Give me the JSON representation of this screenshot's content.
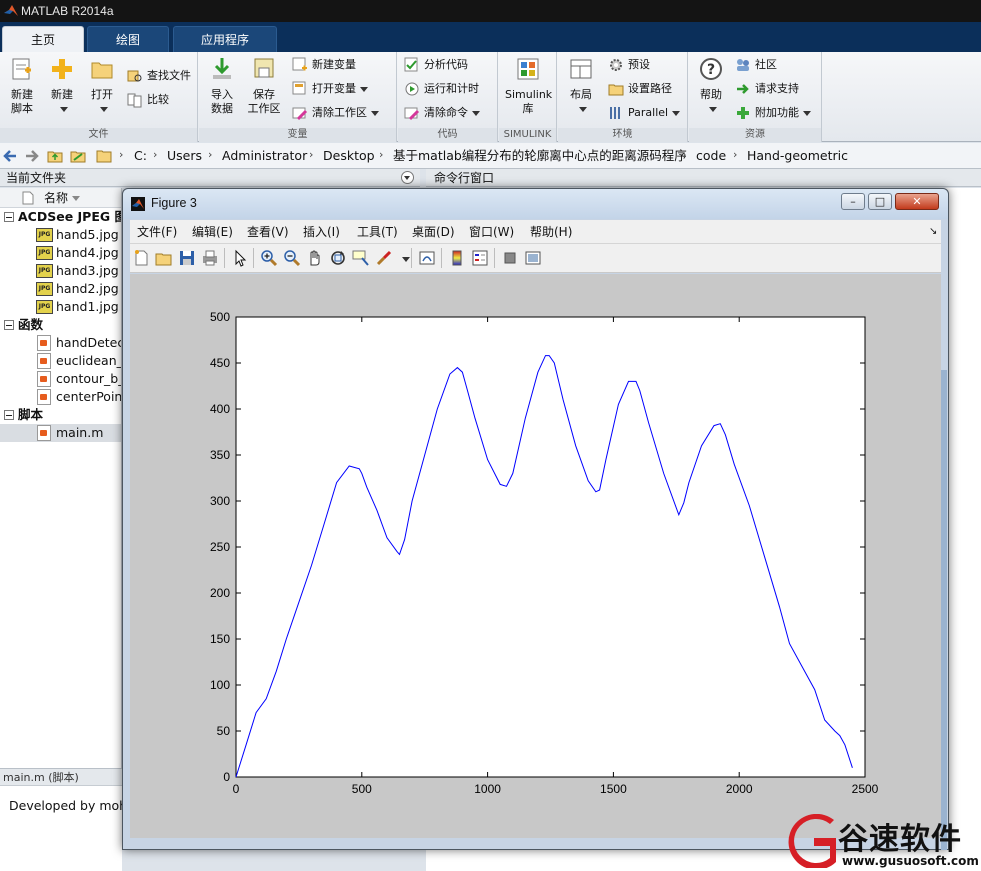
{
  "app": {
    "title": "MATLAB R2014a"
  },
  "ribbon": {
    "tabs": [
      "主页",
      "绘图",
      "应用程序"
    ],
    "groups": {
      "file": {
        "label": "文件",
        "new_script": "新建\n脚本",
        "new": "新建",
        "open": "打开",
        "find_files": "查找文件",
        "compare": "比较"
      },
      "variable": {
        "label": "变量",
        "import": "导入\n数据",
        "save_ws": "保存\n工作区",
        "new_var": "新建变量",
        "open_var": "打开变量",
        "clear_ws": "清除工作区"
      },
      "code": {
        "label": "代码",
        "analyze": "分析代码",
        "run_time": "运行和计时",
        "clear_cmd": "清除命令"
      },
      "simulink": {
        "label": "SIMULINK",
        "lib": "Simulink\n库"
      },
      "env": {
        "label": "环境",
        "layout": "布局",
        "prefs": "预设",
        "set_path": "设置路径",
        "parallel": "Parallel"
      },
      "resources": {
        "label": "资源",
        "help": "帮助",
        "community": "社区",
        "support": "请求支持",
        "addons": "附加功能"
      }
    }
  },
  "address": {
    "crumbs": [
      "C:",
      "Users",
      "Administrator",
      "Desktop",
      "基于matlab编程分布的轮廓离中心点的距离源码程序",
      "code",
      "Hand-geometric"
    ]
  },
  "panels": {
    "current_folder": "当前文件夹",
    "command_window": "命令行窗口",
    "name_col": "名称"
  },
  "files": {
    "groups": [
      {
        "label": "ACDSee JPEG 图像",
        "type": "jpg",
        "items": [
          "hand5.jpg",
          "hand4.jpg",
          "hand3.jpg",
          "hand2.jpg",
          "hand1.jpg"
        ]
      },
      {
        "label": "函数",
        "type": "fx",
        "items": [
          "handDetect",
          "euclidean_d",
          "contour_b_f",
          "centerPoint"
        ]
      },
      {
        "label": "脚本",
        "type": "m",
        "items": [
          "main.m"
        ]
      }
    ],
    "selected": "main.m",
    "jpg_badge": "JPG",
    "fx_badge": "fx"
  },
  "details": {
    "header": "main.m (脚本)",
    "text": "Developed by moh"
  },
  "figure": {
    "title": "Figure 3",
    "menu": [
      "文件(F)",
      "编辑(E)",
      "查看(V)",
      "插入(I)",
      "工具(T)",
      "桌面(D)",
      "窗口(W)",
      "帮助(H)"
    ],
    "toolbar_icons": [
      "new-figure-icon",
      "open-file-icon",
      "save-icon",
      "print-icon",
      "pointer-icon",
      "zoom-in-icon",
      "zoom-out-icon",
      "pan-icon",
      "rotate-icon",
      "data-cursor-icon",
      "brush-icon",
      "link-icon",
      "colorbar-icon",
      "legend-icon",
      "hide-plot-tools-icon",
      "show-plot-tools-icon"
    ]
  },
  "chart_data": {
    "type": "line",
    "title": "",
    "xlabel": "",
    "ylabel": "",
    "xlim": [
      0,
      2500
    ],
    "ylim": [
      0,
      500
    ],
    "xticks": [
      0,
      500,
      1000,
      1500,
      2000,
      2500
    ],
    "yticks": [
      0,
      50,
      100,
      150,
      200,
      250,
      300,
      350,
      400,
      450,
      500
    ],
    "grid": false,
    "series": [
      {
        "color": "#0000ff",
        "x": [
          0,
          40,
          80,
          120,
          160,
          200,
          250,
          300,
          350,
          400,
          450,
          490,
          500,
          520,
          560,
          600,
          640,
          650,
          670,
          700,
          750,
          800,
          850,
          880,
          900,
          920,
          950,
          1000,
          1050,
          1075,
          1100,
          1150,
          1200,
          1230,
          1245,
          1265,
          1300,
          1350,
          1400,
          1430,
          1445,
          1470,
          1520,
          1560,
          1590,
          1605,
          1640,
          1700,
          1760,
          1780,
          1800,
          1850,
          1900,
          1925,
          1945,
          1980,
          2040,
          2100,
          2160,
          2200,
          2250,
          2300,
          2340,
          2380,
          2400,
          2420,
          2450
        ],
        "y": [
          0,
          35,
          70,
          85,
          115,
          150,
          190,
          230,
          275,
          320,
          338,
          335,
          330,
          315,
          290,
          260,
          245,
          242,
          258,
          300,
          350,
          400,
          438,
          445,
          440,
          420,
          390,
          345,
          318,
          316,
          330,
          390,
          440,
          458,
          458,
          450,
          410,
          360,
          322,
          310,
          312,
          345,
          405,
          430,
          430,
          420,
          385,
          330,
          285,
          298,
          320,
          360,
          382,
          384,
          372,
          340,
          295,
          240,
          185,
          145,
          120,
          95,
          62,
          50,
          45,
          35,
          10
        ]
      }
    ]
  },
  "watermark": {
    "text": "谷速软件",
    "url": "www.gusuosoft.com"
  }
}
